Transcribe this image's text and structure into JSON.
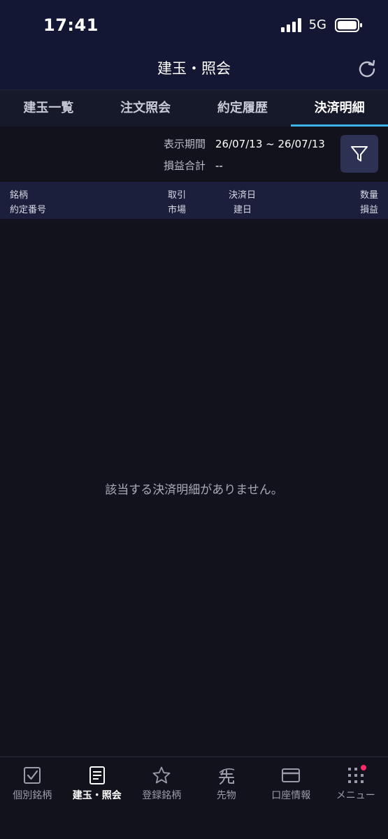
{
  "status_bar": {
    "time": "17:41",
    "network": "5G"
  },
  "header": {
    "title": "建玉・照会",
    "refresh_icon": "refresh-icon"
  },
  "tabs": [
    {
      "label": "建玉一覧",
      "active": false
    },
    {
      "label": "注文照会",
      "active": false
    },
    {
      "label": "約定履歴",
      "active": false
    },
    {
      "label": "決済明細",
      "active": true
    }
  ],
  "filter": {
    "period_label": "表示期間",
    "period_value": "26/07/13 ~ 26/07/13",
    "pnl_label": "損益合計",
    "pnl_value": "--",
    "button_icon": "filter-icon"
  },
  "table_header": {
    "row1": {
      "col1": "銘柄",
      "col2": "取引",
      "col3": "決済日",
      "col4": "数量"
    },
    "row2": {
      "col1": "約定番号",
      "col2": "市場",
      "col3": "建日",
      "col4": "損益"
    }
  },
  "empty_message": "該当する決済明細がありません。",
  "bottom_nav": [
    {
      "label": "個別銘柄",
      "icon": "checkbox-icon",
      "active": false
    },
    {
      "label": "建玉・照会",
      "icon": "document-icon",
      "active": true
    },
    {
      "label": "登録銘柄",
      "icon": "star-icon",
      "active": false
    },
    {
      "label": "先物",
      "icon": "futures-icon",
      "active": false
    },
    {
      "label": "口座情報",
      "icon": "card-icon",
      "active": false
    },
    {
      "label": "メニュー",
      "icon": "grid-icon",
      "active": false,
      "badge": true
    }
  ],
  "colors": {
    "accent": "#3cb4e8",
    "badge": "#ff2b6a",
    "header_bg": "#141734"
  }
}
